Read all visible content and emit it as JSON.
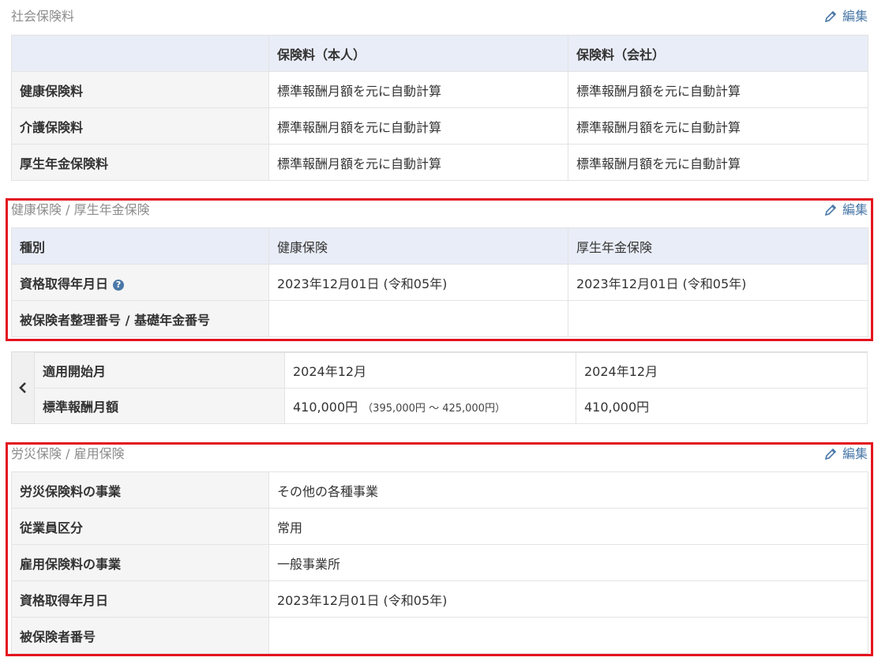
{
  "common": {
    "edit_label": "編集"
  },
  "social_insurance": {
    "title": "社会保険料",
    "headers": [
      "",
      "保険料（本人）",
      "保険料（会社）"
    ],
    "rows": [
      {
        "label": "健康保険料",
        "self": "標準報酬月額を元に自動計算",
        "company": "標準報酬月額を元に自動計算"
      },
      {
        "label": "介護保険料",
        "self": "標準報酬月額を元に自動計算",
        "company": "標準報酬月額を元に自動計算"
      },
      {
        "label": "厚生年金保険料",
        "self": "標準報酬月額を元に自動計算",
        "company": "標準報酬月額を元に自動計算"
      }
    ]
  },
  "health_pension": {
    "title": "健康保険 / 厚生年金保険",
    "header": {
      "label": "種別",
      "col1": "健康保険",
      "col2": "厚生年金保険"
    },
    "rows": [
      {
        "label": "資格取得年月日",
        "col1": "2023年12月01日 (令和05年)",
        "col2": "2023年12月01日 (令和05年)"
      },
      {
        "label": "被保険者整理番号 / 基礎年金番号",
        "col1": "",
        "col2": ""
      }
    ],
    "help_icon": "?"
  },
  "standard_remuneration": {
    "rows": [
      {
        "label": "適用開始月",
        "col1": "2024年12月",
        "col1_note": "",
        "col2": "2024年12月"
      },
      {
        "label": "標準報酬月額",
        "col1": "410,000円",
        "col1_note": "（395,000円 ～ 425,000円）",
        "col2": "410,000円"
      }
    ]
  },
  "workers_employment": {
    "title": "労災保険 / 雇用保険",
    "rows": [
      {
        "label": "労災保険料の事業",
        "value": "その他の各種事業"
      },
      {
        "label": "従業員区分",
        "value": "常用"
      },
      {
        "label": "雇用保険料の事業",
        "value": "一般事業所"
      },
      {
        "label": "資格取得年月日",
        "value": "2023年12月01日 (令和05年)"
      },
      {
        "label": "被保険者番号",
        "value": ""
      }
    ]
  },
  "colors": {
    "highlight": "#e3141e",
    "link": "#4a78a8",
    "header_bg": "#e9edf7",
    "label_bg": "#f5f5f5"
  },
  "icons": {
    "edit": "pencil-icon",
    "prev": "chevron-left-icon",
    "help": "question-circle-icon"
  }
}
